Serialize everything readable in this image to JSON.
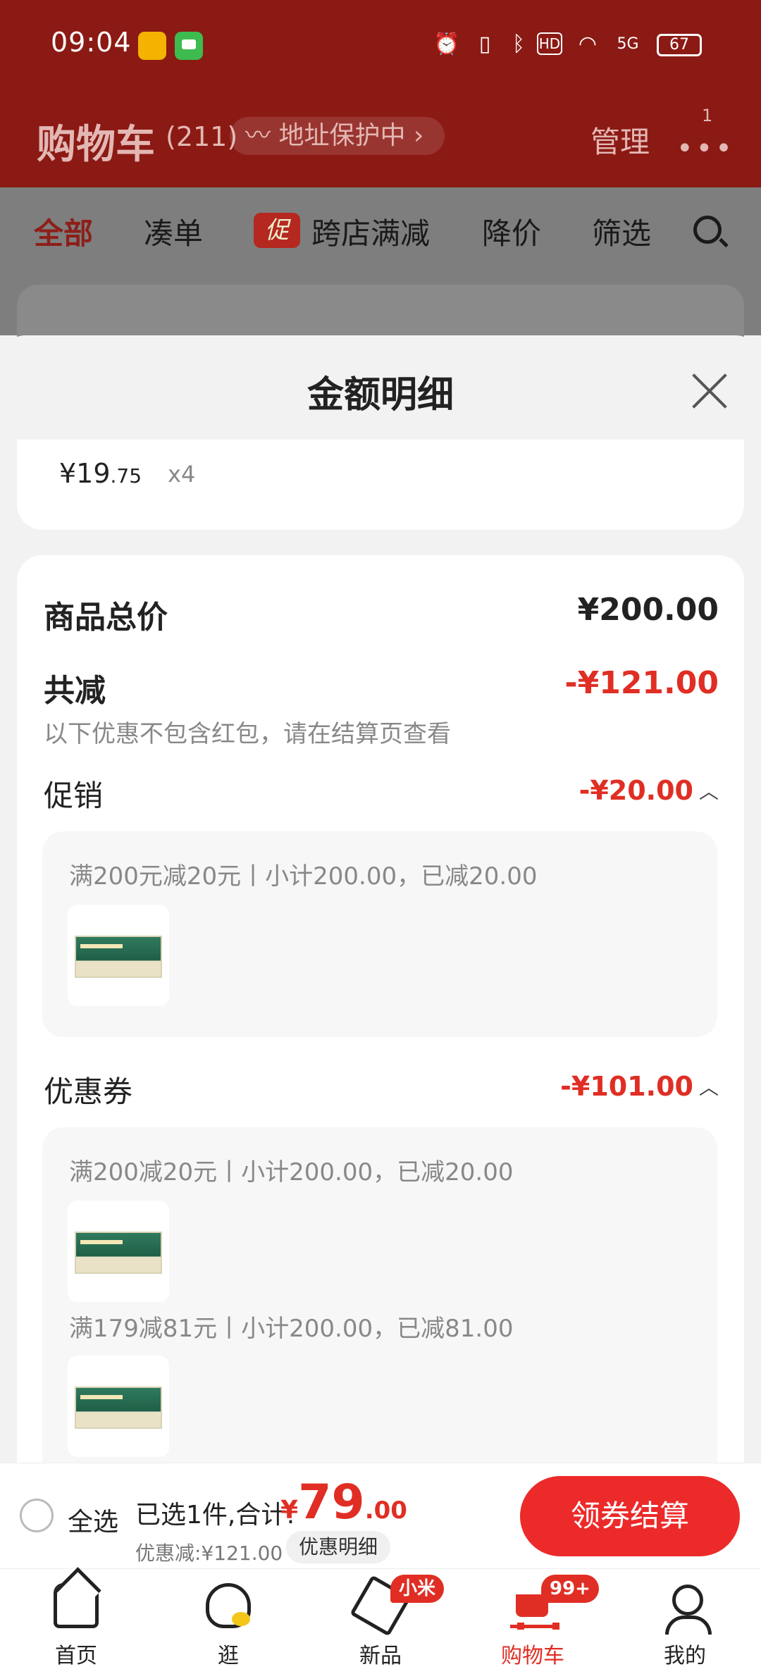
{
  "status_bar": {
    "time": "09:04",
    "network": "5G",
    "hd": "HD",
    "battery": "67"
  },
  "header": {
    "title": "购物车",
    "count": "(211)",
    "address_protect": "地址保护中",
    "manage": "管理",
    "more_badge": "1"
  },
  "filters": {
    "all": "全部",
    "combine": "凑单",
    "promo_tag": "促",
    "cross_store": "跨店满减",
    "price_drop": "降价",
    "filter": "筛选"
  },
  "sheet": {
    "title": "金额明细",
    "item_price_main": "¥19",
    "item_price_decimal": ".75",
    "item_qty": "x4",
    "goods_total_label": "商品总价",
    "goods_total_value": "¥200.00",
    "total_discount_label": "共减",
    "total_discount_value": "-¥121.00",
    "note": "以下优惠不包含红包，请在结算页查看",
    "promotion": {
      "label": "促销",
      "value": "-¥20.00",
      "rule": "满200元减20元丨小计200.00，已减20.00"
    },
    "coupon": {
      "label": "优惠券",
      "value": "-¥101.00",
      "rules": [
        "满200减20元丨小计200.00，已减20.00",
        "满179减81元丨小计200.00，已减81.00"
      ]
    }
  },
  "checkout": {
    "select_all": "全选",
    "summary": "已选1件,合计:",
    "currency": "¥",
    "total_int": "79",
    "total_dec": ".00",
    "discount": "优惠减:¥121.00",
    "detail": "优惠明细",
    "pay_button": "领券结算"
  },
  "tabs": {
    "home": "首页",
    "browse": "逛",
    "new": "新品",
    "new_badge": "小米",
    "cart": "购物车",
    "cart_badge": "99+",
    "mine": "我的"
  }
}
